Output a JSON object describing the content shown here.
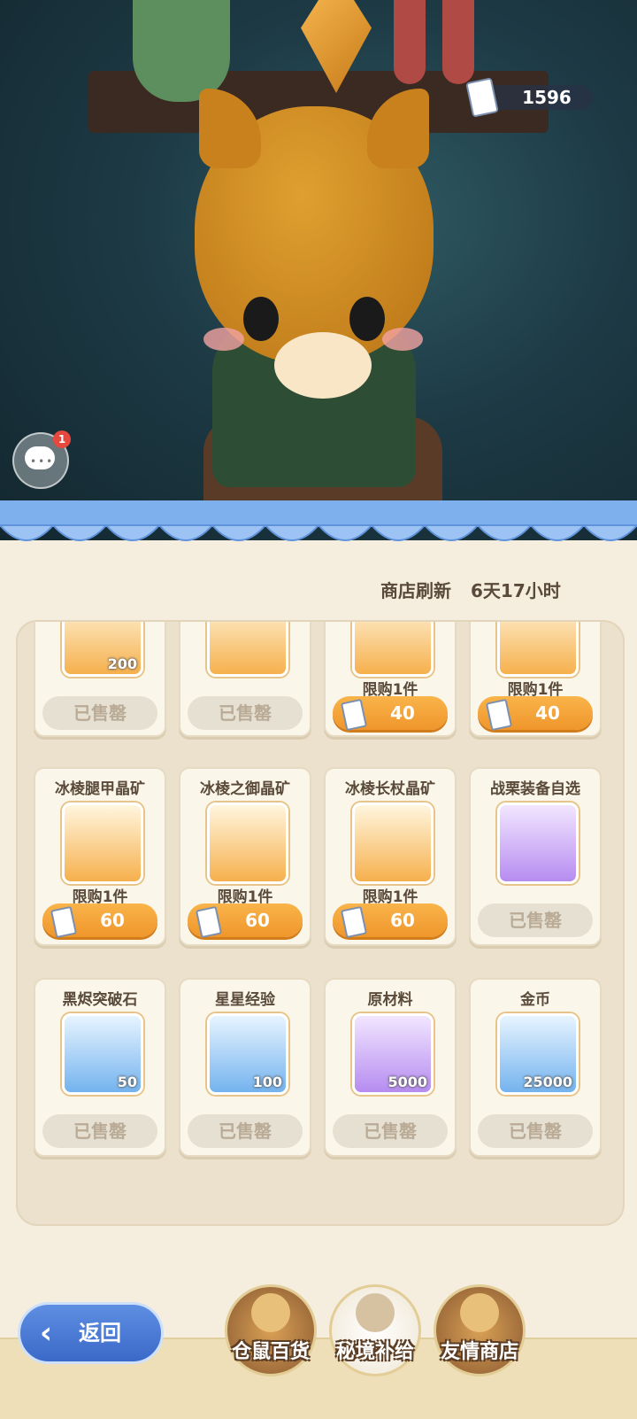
{
  "currency": {
    "amount": "1596",
    "icon": "ticket-icon"
  },
  "chat": {
    "badge_count": "1"
  },
  "shop": {
    "refresh_label": "商店刷新",
    "refresh_time": "6天17小时"
  },
  "items_partial": [
    {
      "qty": "200",
      "button": "已售罄",
      "color": "orange"
    },
    {
      "qty": "",
      "button": "已售罄",
      "color": "orange"
    },
    {
      "limit": "限购1件",
      "price": "40",
      "color": "orange"
    },
    {
      "limit": "限购1件",
      "price": "40",
      "color": "orange"
    }
  ],
  "items": [
    {
      "name": "冰棱腿甲晶矿",
      "limit": "限购1件",
      "price": "60",
      "color": "orange"
    },
    {
      "name": "冰棱之御晶矿",
      "limit": "限购1件",
      "price": "60",
      "color": "orange"
    },
    {
      "name": "冰棱长杖晶矿",
      "limit": "限购1件",
      "price": "60",
      "color": "orange"
    },
    {
      "name": "战栗装备自选",
      "button": "已售罄",
      "color": "purple"
    },
    {
      "name": "黑烬突破石",
      "qty": "50",
      "button": "已售罄",
      "color": "blue"
    },
    {
      "name": "星星经验",
      "qty": "100",
      "button": "已售罄",
      "color": "blue"
    },
    {
      "name": "原材料",
      "qty": "5000",
      "button": "已售罄",
      "color": "purple"
    },
    {
      "name": "金币",
      "qty": "25000",
      "button": "已售罄",
      "color": "blue"
    }
  ],
  "back_button": {
    "label": "返回"
  },
  "tabs": [
    {
      "label": "仓鼠百货"
    },
    {
      "label": "秘境补给"
    },
    {
      "label": "友情商店"
    }
  ]
}
